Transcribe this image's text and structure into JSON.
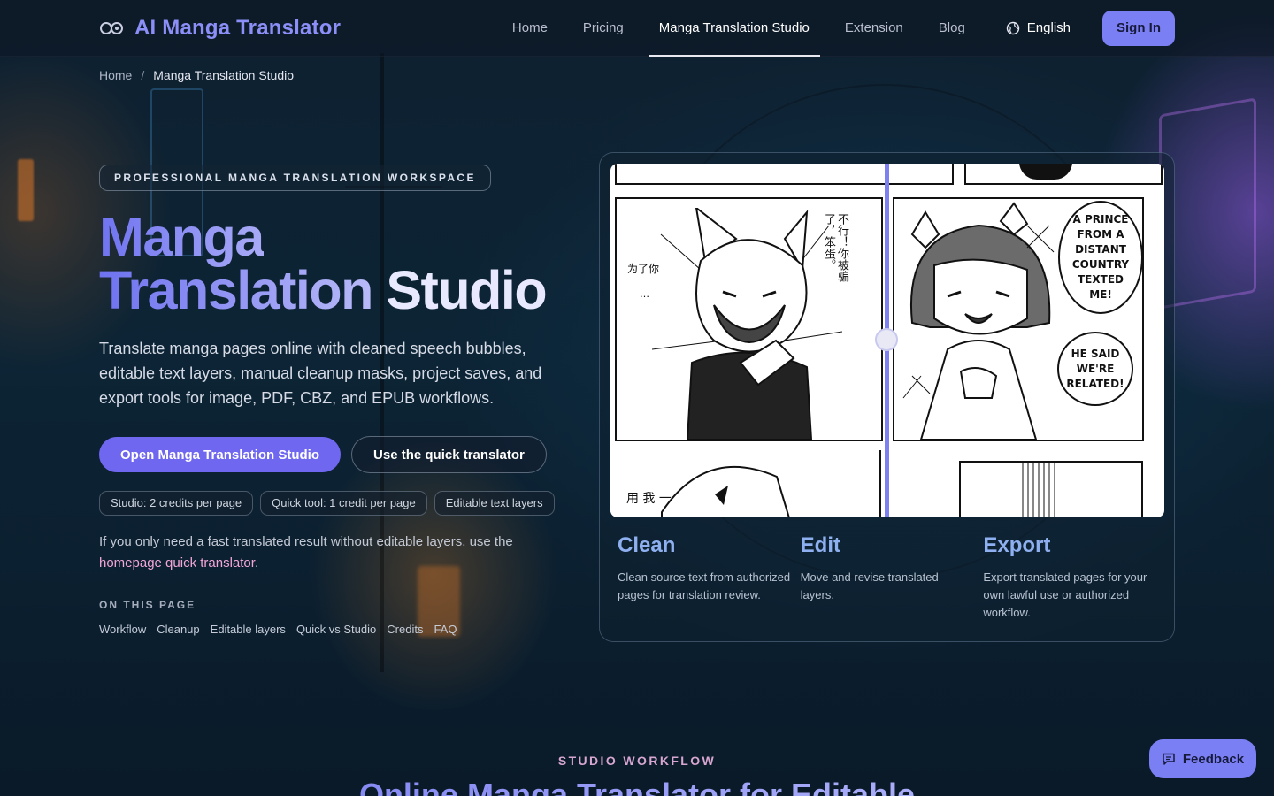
{
  "brand": {
    "name": "AI Manga Translator",
    "logo_icon": "infinity-link-icon"
  },
  "nav": {
    "links": [
      {
        "label": "Home"
      },
      {
        "label": "Pricing"
      },
      {
        "label": "Manga Translation Studio",
        "active": true
      },
      {
        "label": "Extension"
      },
      {
        "label": "Blog"
      }
    ],
    "language": {
      "label": "English",
      "icon": "globe-icon"
    },
    "signin_label": "Sign In"
  },
  "breadcrumb": {
    "home": "Home",
    "separator": "/",
    "current": "Manga Translation Studio"
  },
  "hero": {
    "eyebrow": "PROFESSIONAL MANGA TRANSLATION WORKSPACE",
    "title_line1": "Manga",
    "title_line2a": "Translation",
    "title_line2b": "Studio",
    "description": "Translate manga pages online with cleaned speech bubbles, editable text layers, manual cleanup masks, project saves, and export tools for image, PDF, CBZ, and EPUB workflows.",
    "primary_cta": "Open Manga Translation Studio",
    "secondary_cta": "Use the quick translator",
    "chips": [
      "Studio: 2 credits per page",
      "Quick tool: 1 credit per page",
      "Editable text layers"
    ],
    "note_text": "If you only need a fast translated result without editable layers, use the",
    "note_link": "homepage quick translator",
    "note_end": ".",
    "toc_title": "ON THIS PAGE",
    "toc": [
      "Workflow",
      "Cleanup",
      "Editable layers",
      "Quick vs Studio",
      "Credits",
      "FAQ"
    ]
  },
  "preview": {
    "left_bubble_1": "不行！你被骗了，笨蛋。",
    "left_bubble_2": "为了你",
    "left_bubble_3": "…",
    "left_bottom_text": "用 我 一",
    "right_bubble_1": "A PRINCE FROM A DISTANT COUNTRY TEXTED ME!",
    "right_bubble_2": "HE SAID WE'RE RELATED!",
    "features": [
      {
        "title": "Clean",
        "desc": "Clean source text from authorized pages for translation review."
      },
      {
        "title": "Edit",
        "desc": "Move and revise translated layers."
      },
      {
        "title": "Export",
        "desc": "Export translated pages for your own lawful use or authorized workflow."
      }
    ]
  },
  "section": {
    "eyebrow": "STUDIO WORKFLOW",
    "title": "Online Manga Translator for Editable"
  },
  "feedback": {
    "label": "Feedback",
    "icon": "chat-icon"
  },
  "colors": {
    "accent": "#7b7ff4",
    "link": "#f2a6d9",
    "feature_title": "#8fb0f0"
  }
}
